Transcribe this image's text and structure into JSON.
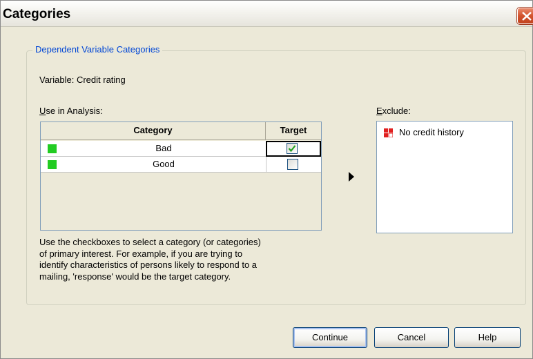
{
  "window": {
    "title": "Categories"
  },
  "group": {
    "legend": "Dependent Variable Categories"
  },
  "variable": {
    "label": "Variable: Credit rating"
  },
  "use_in_analysis": {
    "label_mnemonic": "U",
    "label_rest": "se in Analysis:",
    "columns": [
      "Category",
      "Target"
    ],
    "rows": [
      {
        "category": "Bad",
        "target_checked": true,
        "swatch_color": "#22cc22"
      },
      {
        "category": "Good",
        "target_checked": false,
        "swatch_color": "#22cc22"
      }
    ]
  },
  "help_text": "Use the checkboxes to select a category (or categories) of primary interest. For example, if you are trying to identify characteristics of persons likely to respond to a mailing, 'response' would be the target category.",
  "exclude": {
    "label_mnemonic": "E",
    "label_rest": "xclude:",
    "items": [
      {
        "label": "No credit history",
        "icon": "red-category-icon"
      }
    ]
  },
  "buttons": {
    "continue": "Continue",
    "cancel": "Cancel",
    "help": "Help"
  },
  "colors": {
    "legend": "#0046d5",
    "window_bg": "#ece9d8",
    "swatch": "#22cc22",
    "exclude_icon": "#e02020"
  }
}
